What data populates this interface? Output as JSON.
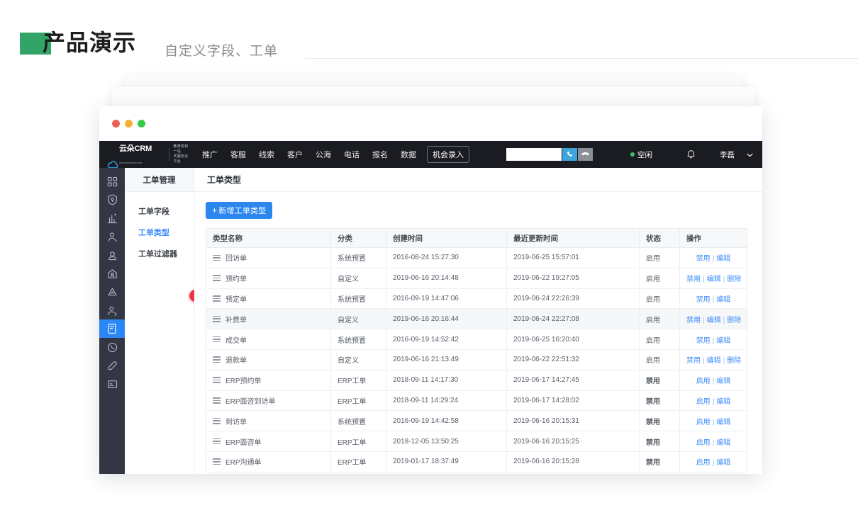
{
  "page": {
    "title": "产品演示",
    "subtitle": "自定义字段、工单",
    "accent_color": "#32a467"
  },
  "window": {
    "traffic_lights": [
      "red",
      "yellow",
      "green"
    ]
  },
  "navbar": {
    "brand": {
      "name": "云朵CRM",
      "url": "www.yunduocrm.com",
      "tagline_line1": "教育机构一站",
      "tagline_line2": "式服务云平台"
    },
    "items": [
      {
        "label": "推广"
      },
      {
        "label": "客服"
      },
      {
        "label": "线索"
      },
      {
        "label": "客户"
      },
      {
        "label": "公海"
      },
      {
        "label": "电话"
      },
      {
        "label": "报名"
      },
      {
        "label": "数据"
      }
    ],
    "entry_button": "机会录入",
    "dial": {
      "value": "",
      "placeholder": "",
      "call_icon": "phone-icon",
      "hangup_icon": "phone-hangup-icon"
    },
    "status": {
      "label": "空闲",
      "color": "#3fc15f"
    },
    "bell_icon": "bell-icon",
    "user": "李磊",
    "caret_icon": "chevron-down-icon"
  },
  "rail": {
    "items": [
      {
        "name": "dashboard",
        "icon": "grid-icon",
        "active": false
      },
      {
        "name": "security",
        "icon": "shield-icon",
        "active": false
      },
      {
        "name": "analytics",
        "icon": "bar-chart-icon",
        "active": false
      },
      {
        "name": "leads",
        "icon": "user-search-icon",
        "active": false
      },
      {
        "name": "customers",
        "icon": "user-card-icon",
        "active": false
      },
      {
        "name": "public-sea",
        "icon": "home-user-icon",
        "active": false
      },
      {
        "name": "recycle",
        "icon": "recycle-icon",
        "active": false
      },
      {
        "name": "staff",
        "icon": "user-group-icon",
        "active": false
      },
      {
        "name": "work-order",
        "icon": "clipboard-icon",
        "active": true
      },
      {
        "name": "call",
        "icon": "phone-circle-icon",
        "active": false
      },
      {
        "name": "edit",
        "icon": "pen-icon",
        "active": false
      },
      {
        "name": "card",
        "icon": "card-icon",
        "active": false
      }
    ]
  },
  "submenu": {
    "title": "工单管理",
    "items": [
      {
        "label": "工单字段",
        "active": false
      },
      {
        "label": "工单类型",
        "active": true
      },
      {
        "label": "工单过滤器",
        "active": false
      }
    ],
    "badge_icon": "flag-badge-icon"
  },
  "content": {
    "title": "工单类型",
    "add_button": {
      "plus": "+",
      "label": "新增工单类型"
    },
    "table": {
      "columns": [
        "类型名称",
        "分类",
        "创建时间",
        "最近更新时间",
        "状态",
        "操作"
      ],
      "rows": [
        {
          "name": "回访单",
          "category": "系统预置",
          "created": "2016-08-24 15:27:30",
          "updated": "2019-06-25 15:57:01",
          "status": "启用",
          "enabled": true,
          "actions": [
            "禁用",
            "编辑"
          ]
        },
        {
          "name": "预约单",
          "category": "自定义",
          "created": "2019-06-16 20:14:48",
          "updated": "2019-06-22 19:27:05",
          "status": "启用",
          "enabled": true,
          "actions": [
            "禁用",
            "编辑",
            "删除"
          ]
        },
        {
          "name": "预定单",
          "category": "系统预置",
          "created": "2016-09-19 14:47:06",
          "updated": "2019-06-24 22:26:39",
          "status": "启用",
          "enabled": true,
          "actions": [
            "禁用",
            "编辑"
          ]
        },
        {
          "name": "补费单",
          "category": "自定义",
          "created": "2019-06-16 20:16:44",
          "updated": "2019-06-24 22:27:08",
          "status": "启用",
          "enabled": true,
          "actions": [
            "禁用",
            "编辑",
            "删除"
          ]
        },
        {
          "name": "成交单",
          "category": "系统预置",
          "created": "2016-09-19 14:52:42",
          "updated": "2019-06-25 16:20:40",
          "status": "启用",
          "enabled": true,
          "actions": [
            "禁用",
            "编辑"
          ]
        },
        {
          "name": "退款单",
          "category": "自定义",
          "created": "2019-06-16 21:13:49",
          "updated": "2019-06-22 22:51:32",
          "status": "启用",
          "enabled": true,
          "actions": [
            "禁用",
            "编辑",
            "删除"
          ]
        },
        {
          "name": "ERP预约单",
          "category": "ERP工单",
          "created": "2018-09-11 14:17:30",
          "updated": "2019-06-17 14:27:45",
          "status": "禁用",
          "enabled": false,
          "actions": [
            "启用",
            "编辑"
          ]
        },
        {
          "name": "ERP面咨到访单",
          "category": "ERP工单",
          "created": "2018-09-11 14:29:24",
          "updated": "2019-06-17 14:28:02",
          "status": "禁用",
          "enabled": false,
          "actions": [
            "启用",
            "编辑"
          ]
        },
        {
          "name": "到访单",
          "category": "系统预置",
          "created": "2016-09-19 14:42:58",
          "updated": "2019-06-16 20:15:31",
          "status": "禁用",
          "enabled": false,
          "actions": [
            "启用",
            "编辑"
          ]
        },
        {
          "name": "ERP面咨单",
          "category": "ERP工单",
          "created": "2018-12-05 13:50:25",
          "updated": "2019-06-16 20:15:25",
          "status": "禁用",
          "enabled": false,
          "actions": [
            "启用",
            "编辑"
          ]
        },
        {
          "name": "ERP沟通单",
          "category": "ERP工单",
          "created": "2019-01-17 18:37:49",
          "updated": "2019-06-16 20:15:28",
          "status": "禁用",
          "enabled": false,
          "actions": [
            "启用",
            "编辑"
          ]
        }
      ],
      "alt_row_index": 3
    }
  },
  "colors": {
    "primary": "#2b86f0",
    "link": "#3d8ef8",
    "danger": "#e8464f",
    "nav_bg": "#1b1c22",
    "rail_bg": "#333744"
  }
}
